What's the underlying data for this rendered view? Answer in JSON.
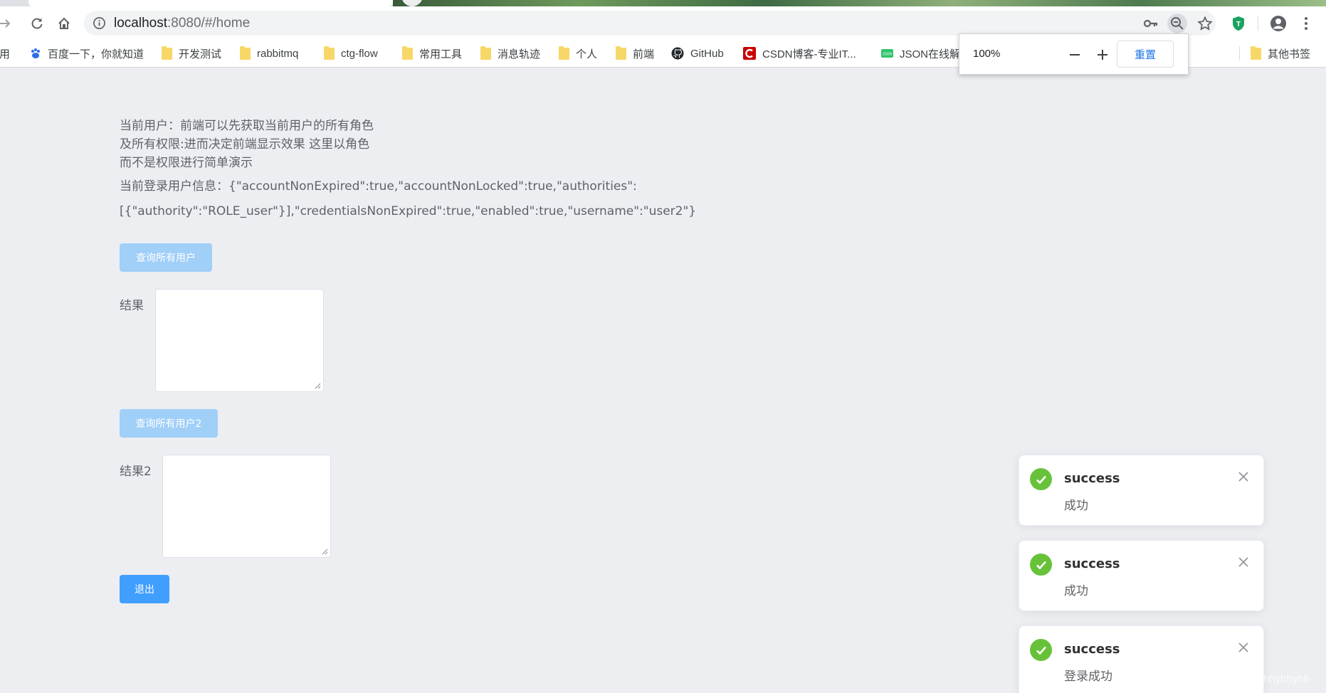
{
  "browser": {
    "url_host": "localhost",
    "url_path": ":8080/#/home",
    "bookmarks": [
      {
        "label": "应用",
        "icon": "apps-icon"
      },
      {
        "label": "百度一下，你就知道",
        "icon": "baidu-icon"
      },
      {
        "label": "开发测试",
        "icon": "folder-icon"
      },
      {
        "label": "rabbitmq",
        "icon": "folder-icon"
      },
      {
        "label": "ctg-flow",
        "icon": "folder-icon"
      },
      {
        "label": "常用工具",
        "icon": "folder-icon"
      },
      {
        "label": "消息轨迹",
        "icon": "folder-icon"
      },
      {
        "label": "个人",
        "icon": "folder-icon"
      },
      {
        "label": "前端",
        "icon": "folder-icon"
      },
      {
        "label": "GitHub",
        "icon": "github-icon"
      },
      {
        "label": "CSDN博客-专业IT...",
        "icon": "csdn-icon"
      },
      {
        "label": "JSON在线解",
        "icon": "json-icon"
      },
      {
        "label": "其他书签",
        "icon": "folder-icon"
      }
    ],
    "zoom_popup": {
      "level": "100%",
      "reset_label": "重置"
    },
    "colors": {
      "accent": "#1a73e8",
      "shield": "#1aa260"
    }
  },
  "page": {
    "desc_line1": "当前用户：前端可以先获取当前用户的所有角色",
    "desc_line2": "及所有权限:进而决定前端显示效果 这里以角色",
    "desc_line3": "而不是权限进行简单演示",
    "user_info_line1": "当前登录用户信息：{\"accountNonExpired\":true,\"accountNonLocked\":true,\"authorities\":",
    "user_info_line2": "[{\"authority\":\"ROLE_user\"}],\"credentialsNonExpired\":true,\"enabled\":true,\"username\":\"user2\"}",
    "query_all_button": "查询所有用户",
    "result_label": "结果",
    "result_value": "",
    "query_all2_button": "查询所有用户2",
    "result2_label": "结果2",
    "result2_value": "",
    "logout_button": "退出",
    "colors": {
      "primary": "#409eff",
      "disabled": "#a0cff8",
      "background": "#eceef2"
    }
  },
  "notifications": [
    {
      "title": "success",
      "message": "成功"
    },
    {
      "title": "success",
      "message": "成功"
    },
    {
      "title": "success",
      "message": "登录成功"
    }
  ],
  "watermark": "https://blog.csdn.net/yhhyhhyhhyhh"
}
